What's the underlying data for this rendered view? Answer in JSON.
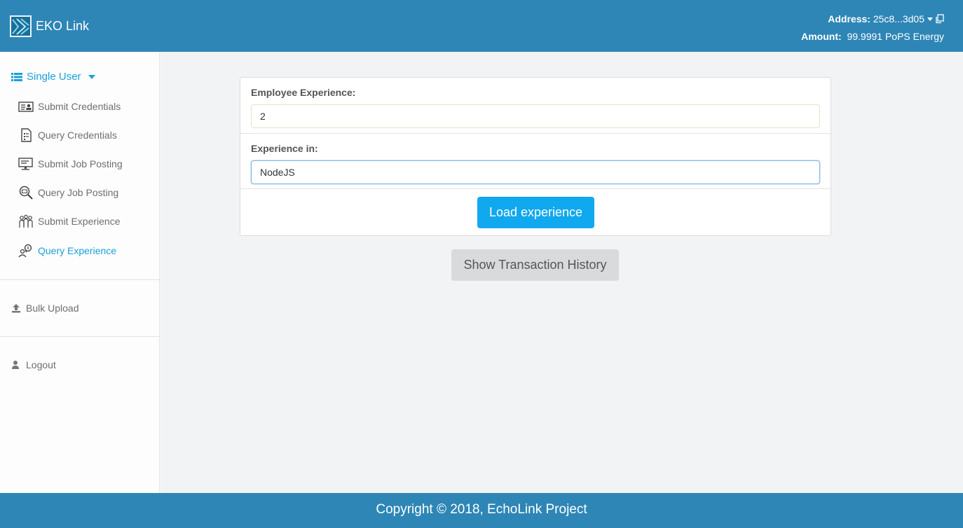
{
  "header": {
    "brand": "EKO Link",
    "address_label": "Address:",
    "address_value": "25c8...3d05",
    "amount_label": "Amount:",
    "amount_value": "99.9991 PoPS Energy"
  },
  "sidebar": {
    "section_title": "Single User",
    "items": [
      {
        "label": "Submit Credentials",
        "icon": "id-card-icon"
      },
      {
        "label": "Query Credentials",
        "icon": "document-icon"
      },
      {
        "label": "Submit Job Posting",
        "icon": "monitor-icon"
      },
      {
        "label": "Query Job Posting",
        "icon": "magnifier-icon"
      },
      {
        "label": "Submit Experience",
        "icon": "people-icon"
      },
      {
        "label": "Query Experience",
        "icon": "user-search-icon"
      }
    ],
    "bulk_upload": "Bulk Upload",
    "logout": "Logout"
  },
  "form": {
    "experience_label": "Employee Experience:",
    "experience_value": "2",
    "experience_in_label": "Experience in:",
    "experience_in_value": "NodeJS",
    "load_button": "Load experience",
    "history_button": "Show Transaction History"
  },
  "footer": {
    "copyright": "Copyright © 2018, EchoLink Project"
  },
  "colors": {
    "header_bg": "#2e86b6",
    "accent": "#1aa0db",
    "primary_button": "#10a8ee",
    "secondary_button": "#d9dadb"
  }
}
